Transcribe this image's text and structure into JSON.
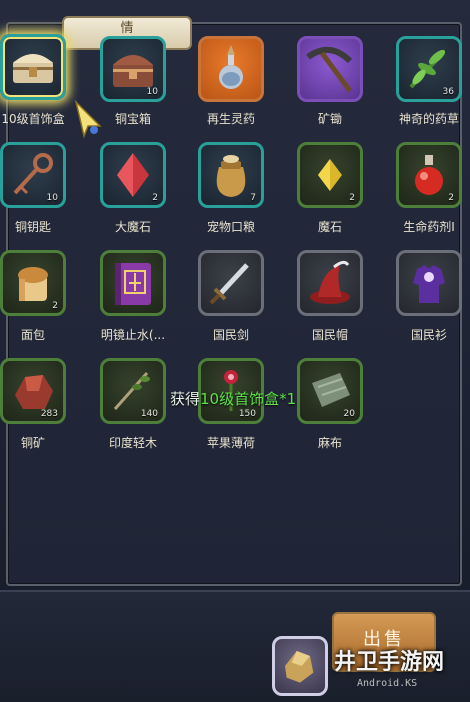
{
  "header": {
    "tab_label": "情"
  },
  "items": [
    {
      "name": "10级首饰盒",
      "count": "",
      "icon": "chest-icon",
      "quality": "teal",
      "selected": true
    },
    {
      "name": "铜宝箱",
      "count": "10",
      "icon": "chest-icon",
      "quality": "teal"
    },
    {
      "name": "再生灵药",
      "count": "",
      "icon": "potion-icon",
      "quality": "orange"
    },
    {
      "name": "矿锄",
      "count": "",
      "icon": "pickaxe-icon",
      "quality": "purple"
    },
    {
      "name": "神奇的药草",
      "count": "36",
      "icon": "herb-icon",
      "quality": "teal"
    },
    {
      "name": "铜钥匙",
      "count": "10",
      "icon": "key-icon",
      "quality": "teal"
    },
    {
      "name": "大魔石",
      "count": "2",
      "icon": "gem-icon",
      "quality": "teal"
    },
    {
      "name": "宠物口粮",
      "count": "7",
      "icon": "sack-icon",
      "quality": "teal"
    },
    {
      "name": "魔石",
      "count": "2",
      "icon": "gem-icon",
      "quality": "green"
    },
    {
      "name": "生命药剂I",
      "count": "2",
      "icon": "potion-icon",
      "quality": "green"
    },
    {
      "name": "面包",
      "count": "2",
      "icon": "bread-icon",
      "quality": "green"
    },
    {
      "name": "明镜止水(...",
      "count": "",
      "icon": "book-icon",
      "quality": "green"
    },
    {
      "name": "国民剑",
      "count": "",
      "icon": "sword-icon",
      "quality": "gray"
    },
    {
      "name": "国民帽",
      "count": "",
      "icon": "hat-icon",
      "quality": "gray"
    },
    {
      "name": "国民衫",
      "count": "",
      "icon": "shirt-icon",
      "quality": "gray"
    },
    {
      "name": "铜矿",
      "count": "283",
      "icon": "ore-icon",
      "quality": "green"
    },
    {
      "name": "印度轻木",
      "count": "140",
      "icon": "branch-icon",
      "quality": "green"
    },
    {
      "name": "苹果薄荷",
      "count": "150",
      "icon": "flower-icon",
      "quality": "green"
    },
    {
      "name": "麻布",
      "count": "20",
      "icon": "cloth-icon",
      "quality": "green"
    }
  ],
  "toast": {
    "prefix": "获得",
    "item": "10级首饰盒",
    "suffix": "*1"
  },
  "footer": {
    "sell_label": "出售"
  },
  "watermark": {
    "main": "井卫手游网",
    "sub": "Android.KS"
  }
}
